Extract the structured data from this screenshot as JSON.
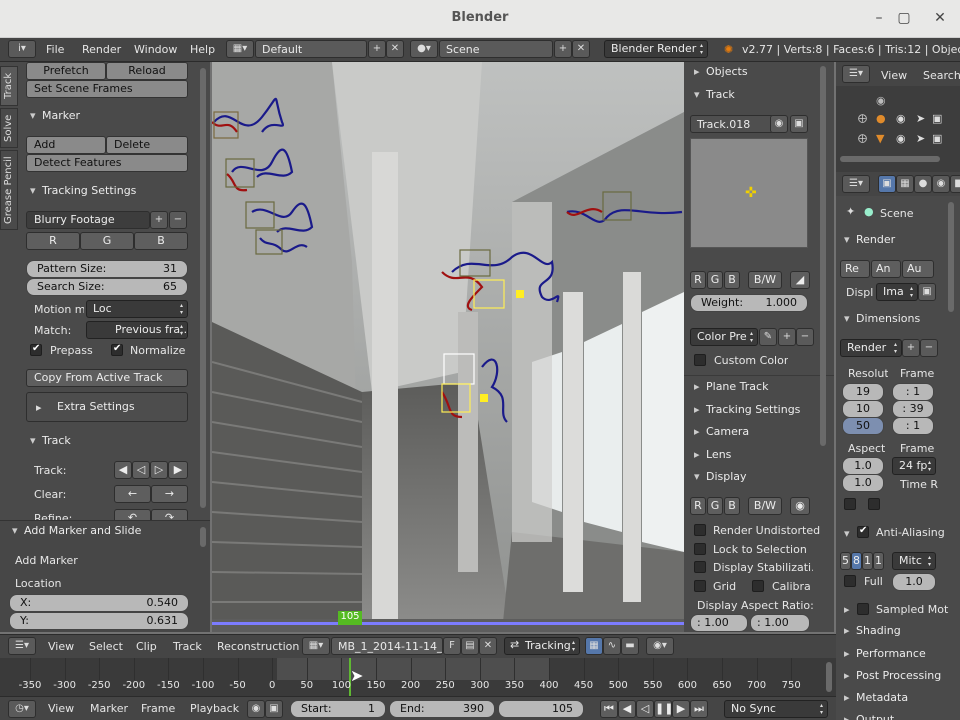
{
  "window": {
    "title": "Blender"
  },
  "menubar": {
    "file": "File",
    "render": "Render",
    "window": "Window",
    "help": "Help",
    "layout": "Default",
    "scene": "Scene",
    "engine": "Blender Render",
    "stats": "v2.77 | Verts:8 | Faces:6 | Tris:12 | Objects:1/"
  },
  "left_tabs": {
    "track": "Track",
    "solve": "Solve",
    "grease": "Grease Pencil"
  },
  "left": {
    "prefetch": "Prefetch",
    "reload": "Reload",
    "set_scene_frames": "Set Scene Frames",
    "marker_title": "Marker",
    "add": "Add",
    "delete": "Delete",
    "detect": "Detect Features",
    "tracking_title": "Tracking Settings",
    "preset": "Blurry Footage",
    "r": "R",
    "g": "G",
    "b": "B",
    "pattern_label": "Pattern Size:",
    "pattern_value": "31",
    "search_label": "Search Size:",
    "search_value": "65",
    "motion_label": "Motion m",
    "motion_value": "Loc",
    "match_label": "Match:",
    "match_value": "Previous fra...",
    "prepass": "Prepass",
    "normalize": "Normalize",
    "copy": "Copy From Active Track",
    "extra": "Extra Settings",
    "track_title": "Track",
    "track_label": "Track:",
    "clear_label": "Clear:",
    "refine_label": "Refine:"
  },
  "operator": {
    "title": "Add Marker and Slide",
    "add_marker": "Add Marker",
    "location": "Location",
    "x_label": "X:",
    "x_value": "0.540",
    "y_label": "Y:",
    "y_value": "0.631"
  },
  "viewport": {
    "frame_marker": "105"
  },
  "right": {
    "objects": "Objects",
    "track": "Track",
    "track_name": "Track.018",
    "r": "R",
    "g": "G",
    "b": "B",
    "bw": "B/W",
    "weight_label": "Weight:",
    "weight_value": "1.000",
    "color_preset": "Color Pre",
    "custom_color": "Custom Color",
    "plane_track": "Plane Track",
    "tracking_settings": "Tracking Settings",
    "camera": "Camera",
    "lens": "Lens",
    "display": "Display",
    "render_undistorted": "Render Undistorted",
    "lock_selection": "Lock to Selection",
    "display_stab": "Display Stabilizati...",
    "grid": "Grid",
    "calibra": "Calibra",
    "aspect_label": "Display Aspect Ratio:",
    "aspect_x": ": 1.00",
    "aspect_y": ": 1.00"
  },
  "outliner": {
    "view": "View",
    "search": "Search"
  },
  "properties": {
    "scene": "Scene",
    "render": "Render",
    "render_btn": "Re",
    "anim_btn": "An",
    "audio_btn": "Au",
    "displ": "Displ",
    "displ_value": "Ima",
    "dimensions": "Dimensions",
    "preset": "Render",
    "resolution": "Resoluti",
    "frame": "Frame",
    "res_x": "19",
    "res_y": "10",
    "res_pct": "50",
    "frame_start": ": 1",
    "frame_end": ": 39",
    "frame_step": ": 1",
    "aspect": "Aspect",
    "frame_rate": "Frame",
    "asp_x": "1.0",
    "asp_y": "1.0",
    "fps": "24 fp",
    "time_r": "Time R",
    "aa": "Anti-Aliasing",
    "aa_5": "5",
    "aa_8": "8",
    "aa_11": "1",
    "aa_16": "1",
    "filter": "Mitc",
    "full": "Full",
    "full_value": "1.0",
    "sampled_motion": "Sampled Mot",
    "shading": "Shading",
    "performance": "Performance",
    "post": "Post Processing",
    "metadata": "Metadata",
    "output": "Output"
  },
  "clip_header": {
    "view": "View",
    "select": "Select",
    "clip": "Clip",
    "track": "Track",
    "reconstruction": "Reconstruction",
    "clip_name": "MB_1_2014-11-14_...",
    "f": "F",
    "mode": "Tracking"
  },
  "timeline": {
    "ticks": [
      "-350",
      "-300",
      "-250",
      "-200",
      "-150",
      "-100",
      "-50",
      "0",
      "50",
      "100",
      "150",
      "200",
      "250",
      "300",
      "350",
      "400",
      "450",
      "500",
      "550",
      "600",
      "650",
      "700",
      "750"
    ],
    "view": "View",
    "marker": "Marker",
    "frame": "Frame",
    "playback": "Playback",
    "start_label": "Start:",
    "start_value": "1",
    "end_label": "End:",
    "end_value": "390",
    "current": "105",
    "sync": "No Sync"
  }
}
